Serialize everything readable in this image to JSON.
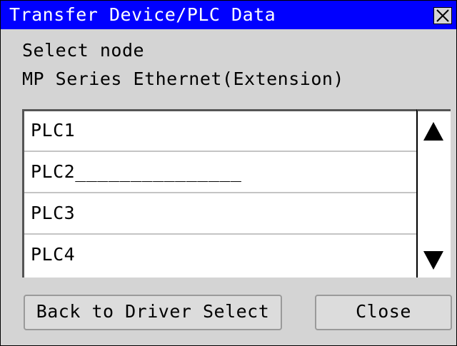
{
  "window": {
    "title": "Transfer Device/PLC Data",
    "close_icon": "close-icon"
  },
  "info": {
    "instruction": "Select node",
    "driver_name": "MP Series Ethernet(Extension)"
  },
  "node_list": {
    "items": [
      {
        "label": "PLC1"
      },
      {
        "label": "PLC2_______________"
      },
      {
        "label": "PLC3"
      },
      {
        "label": "PLC4"
      }
    ],
    "scroll_up_icon": "triangle-up-icon",
    "scroll_down_icon": "triangle-down-icon"
  },
  "buttons": {
    "back_label": "Back to Driver Select",
    "close_label": "Close"
  },
  "colors": {
    "title_bar": "#0000ff",
    "background": "#d4d4d4"
  }
}
